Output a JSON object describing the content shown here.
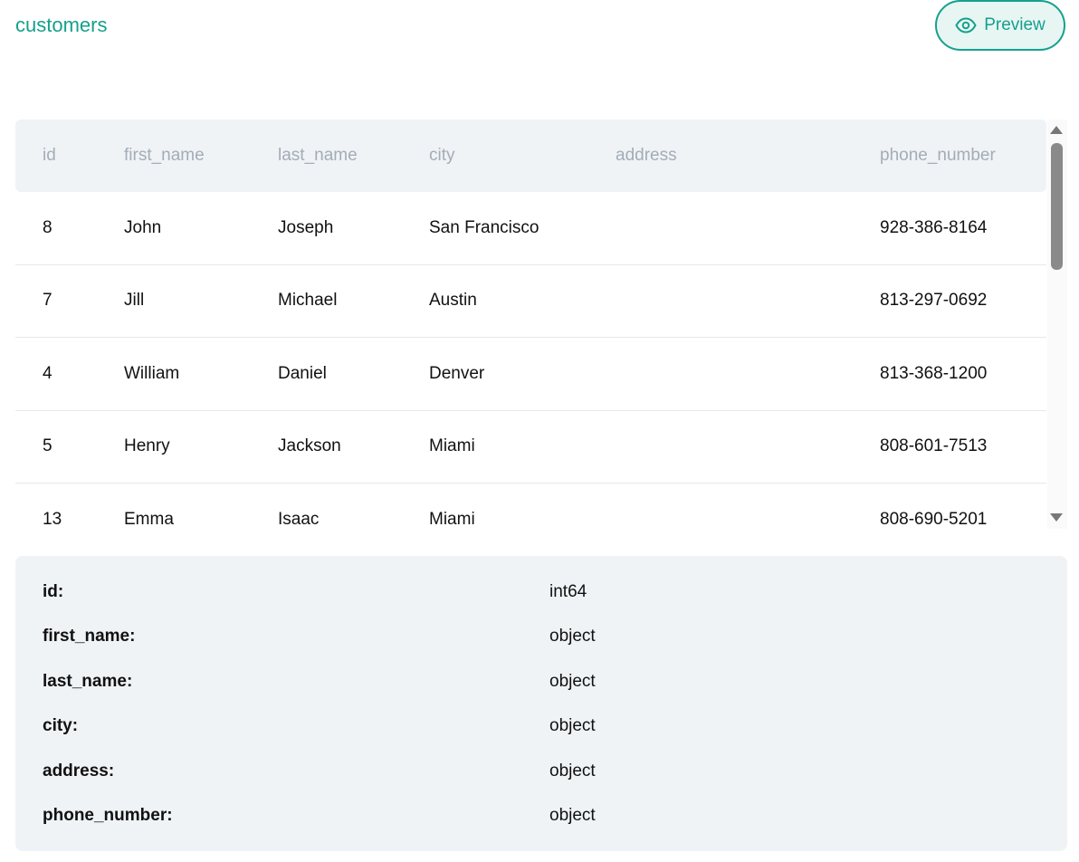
{
  "header": {
    "title": "customers",
    "preview_label": "Preview"
  },
  "table": {
    "columns": [
      "id",
      "first_name",
      "last_name",
      "city",
      "address",
      "phone_number"
    ],
    "rows": [
      {
        "id": "8",
        "first_name": "John",
        "last_name": "Joseph",
        "city": "San Francisco",
        "address": "",
        "phone_number": "928-386-8164"
      },
      {
        "id": "7",
        "first_name": "Jill",
        "last_name": "Michael",
        "city": "Austin",
        "address": "",
        "phone_number": "813-297-0692"
      },
      {
        "id": "4",
        "first_name": "William",
        "last_name": "Daniel",
        "city": "Denver",
        "address": "",
        "phone_number": "813-368-1200"
      },
      {
        "id": "5",
        "first_name": "Henry",
        "last_name": "Jackson",
        "city": "Miami",
        "address": "",
        "phone_number": "808-601-7513"
      },
      {
        "id": "13",
        "first_name": "Emma",
        "last_name": "Isaac",
        "city": "Miami",
        "address": "",
        "phone_number": "808-690-5201"
      }
    ]
  },
  "schema": [
    {
      "key": "id:",
      "type": "int64"
    },
    {
      "key": "first_name:",
      "type": "object"
    },
    {
      "key": "last_name:",
      "type": "object"
    },
    {
      "key": "city:",
      "type": "object"
    },
    {
      "key": "address:",
      "type": "object"
    },
    {
      "key": "phone_number:",
      "type": "object"
    }
  ],
  "colors": {
    "accent": "#16a08c",
    "accent_bg": "#e7f6f3",
    "header_bg": "#f0f3f6",
    "header_text": "#a3adb7"
  },
  "icons": {
    "preview": "eye-icon",
    "scroll_up": "triangle-up-icon",
    "scroll_down": "triangle-down-icon"
  }
}
